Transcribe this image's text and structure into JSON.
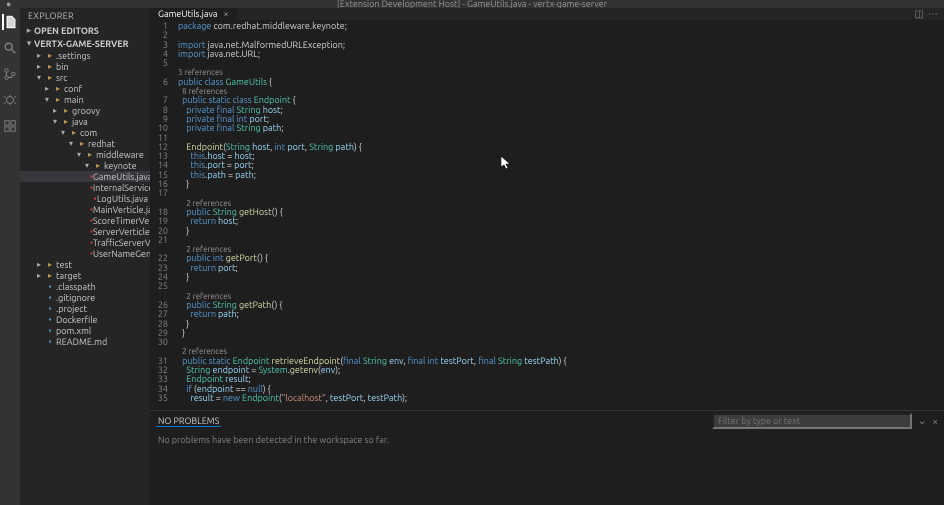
{
  "title": "[Extension Development Host] - GameUtils.java - vertx-game-server",
  "sidebar": {
    "header": "EXPLORER",
    "sections": {
      "open_editors": "OPEN EDITORS",
      "workspace": "VERTX-GAME-SERVER"
    }
  },
  "tree": [
    {
      "d": 1,
      "k": "dir",
      "t": ".settings",
      "open": false
    },
    {
      "d": 1,
      "k": "dir",
      "t": "bin",
      "open": false
    },
    {
      "d": 1,
      "k": "dir",
      "t": "src",
      "open": true
    },
    {
      "d": 2,
      "k": "dir",
      "t": "conf",
      "open": false
    },
    {
      "d": 2,
      "k": "dir",
      "t": "main",
      "open": true
    },
    {
      "d": 3,
      "k": "dir",
      "t": "groovy",
      "open": false
    },
    {
      "d": 3,
      "k": "dir",
      "t": "java",
      "open": true
    },
    {
      "d": 4,
      "k": "dir",
      "t": "com",
      "open": true
    },
    {
      "d": 5,
      "k": "dir",
      "t": "redhat",
      "open": true
    },
    {
      "d": 6,
      "k": "dir",
      "t": "middleware",
      "open": true
    },
    {
      "d": 7,
      "k": "dir",
      "t": "keynote",
      "open": true
    },
    {
      "d": 8,
      "k": "java",
      "t": "GameUtils.java",
      "sel": true
    },
    {
      "d": 8,
      "k": "java",
      "t": "InternalServiceVer…"
    },
    {
      "d": 8,
      "k": "java",
      "t": "LogUtils.java"
    },
    {
      "d": 8,
      "k": "java",
      "t": "MainVerticle.java"
    },
    {
      "d": 8,
      "k": "java",
      "t": "ScoreTimerVerticl…"
    },
    {
      "d": 8,
      "k": "java",
      "t": "ServerVerticle.java"
    },
    {
      "d": 8,
      "k": "java",
      "t": "TrafficServerVertl…"
    },
    {
      "d": 8,
      "k": "java",
      "t": "UserNameGenerat…"
    },
    {
      "d": 1,
      "k": "dir",
      "t": "test",
      "open": false,
      "red": true
    },
    {
      "d": 1,
      "k": "dir",
      "t": "target",
      "open": false
    },
    {
      "d": 1,
      "k": "file",
      "t": ".classpath"
    },
    {
      "d": 1,
      "k": "file",
      "t": ".gitignore"
    },
    {
      "d": 1,
      "k": "file",
      "t": ".project"
    },
    {
      "d": 1,
      "k": "file",
      "t": "Dockerfile"
    },
    {
      "d": 1,
      "k": "file",
      "t": "pom.xml"
    },
    {
      "d": 1,
      "k": "file",
      "t": "README.md"
    }
  ],
  "tab": {
    "name": "GameUtils.java"
  },
  "code_lines": [
    {
      "n": 1,
      "h": "<span class='kw'>package</span> <span class='ns'>com.redhat.middleware.keynote</span>;"
    },
    {
      "n": 2,
      "h": ""
    },
    {
      "n": 3,
      "h": "<span class='kw'>import</span> <span class='ns'>java.net.MalformedURLException</span>;"
    },
    {
      "n": 4,
      "h": "<span class='kw'>import</span> <span class='ns'>java.net.URL</span>;"
    },
    {
      "n": 5,
      "h": ""
    },
    {
      "n": "",
      "h": "<span class='lens'>3 references</span>"
    },
    {
      "n": 6,
      "h": "<span class='kw'>public</span> <span class='kw'>class</span> <span class='ty'>GameUtils</span> {"
    },
    {
      "n": "",
      "h": "  <span class='lens'>8 references</span>"
    },
    {
      "n": 7,
      "h": "  <span class='kw'>public</span> <span class='kw'>static</span> <span class='kw'>class</span> <span class='ty'>Endpoint</span> {"
    },
    {
      "n": 8,
      "h": "    <span class='kw'>private</span> <span class='kw'>final</span> <span class='ty'>String</span> <span class='fld'>host</span>;"
    },
    {
      "n": 9,
      "h": "    <span class='kw'>private</span> <span class='kw'>final</span> <span class='kw'>int</span> <span class='fld'>port</span>;"
    },
    {
      "n": 10,
      "h": "    <span class='kw'>private</span> <span class='kw'>final</span> <span class='ty'>String</span> <span class='fld'>path</span>;"
    },
    {
      "n": 11,
      "h": ""
    },
    {
      "n": 12,
      "h": "    <span class='fn'>Endpoint</span>(<span class='ty'>String</span> <span class='fld'>host</span>, <span class='kw'>int</span> <span class='fld'>port</span>, <span class='ty'>String</span> <span class='fld'>path</span>) {"
    },
    {
      "n": 13,
      "h": "      <span class='kw'>this</span>.<span class='fld'>host</span> = <span class='fld'>host</span>;"
    },
    {
      "n": 14,
      "h": "      <span class='kw'>this</span>.<span class='fld'>port</span> = <span class='fld'>port</span>;"
    },
    {
      "n": 15,
      "h": "      <span class='kw'>this</span>.<span class='fld'>path</span> = <span class='fld'>path</span>;"
    },
    {
      "n": 16,
      "h": "    }"
    },
    {
      "n": 17,
      "h": ""
    },
    {
      "n": "",
      "h": "    <span class='lens'>2 references</span>"
    },
    {
      "n": 18,
      "h": "    <span class='kw'>public</span> <span class='ty'>String</span> <span class='fn'>getHost</span>() {"
    },
    {
      "n": 19,
      "h": "      <span class='kw'>return</span> <span class='fld'>host</span>;"
    },
    {
      "n": 20,
      "h": "    }"
    },
    {
      "n": 21,
      "h": ""
    },
    {
      "n": "",
      "h": "    <span class='lens'>2 references</span>"
    },
    {
      "n": 22,
      "h": "    <span class='kw'>public</span> <span class='kw'>int</span> <span class='fn'>getPort</span>() {"
    },
    {
      "n": 23,
      "h": "      <span class='kw'>return</span> <span class='fld'>port</span>;"
    },
    {
      "n": 24,
      "h": "    }"
    },
    {
      "n": 25,
      "h": ""
    },
    {
      "n": "",
      "h": "    <span class='lens'>2 references</span>"
    },
    {
      "n": 26,
      "h": "    <span class='kw'>public</span> <span class='ty'>String</span> <span class='fn'>getPath</span>() {"
    },
    {
      "n": 27,
      "h": "      <span class='kw'>return</span> <span class='fld'>path</span>;"
    },
    {
      "n": 28,
      "h": "    }"
    },
    {
      "n": 29,
      "h": "  }"
    },
    {
      "n": 30,
      "h": ""
    },
    {
      "n": "",
      "h": "  <span class='lens'>2 references</span>"
    },
    {
      "n": 31,
      "h": "  <span class='kw'>public</span> <span class='kw'>static</span> <span class='ty'>Endpoint</span> <span class='fn'>retrieveEndpoint</span>(<span class='kw'>final</span> <span class='ty'>String</span> <span class='fld'>env</span>, <span class='kw'>final</span> <span class='kw'>int</span> <span class='fld'>testPort</span>, <span class='kw'>final</span> <span class='ty'>String</span> <span class='fld'>testPath</span>) {"
    },
    {
      "n": 32,
      "h": "    <span class='ty'>String</span> <span class='fld'>endpoint</span> = <span class='ty'>System</span>.<span class='fn'>getenv</span>(<span class='fld'>env</span>);"
    },
    {
      "n": 33,
      "h": "    <span class='ty'>Endpoint</span> <span class='fld'>result</span>;"
    },
    {
      "n": 34,
      "h": "    <span class='kw'>if</span> (<span class='fld'>endpoint</span> == <span class='kw'>null</span>) {"
    },
    {
      "n": 35,
      "h": "      <span class='fld'>result</span> = <span class='kw'>new</span> <span class='ty'>Endpoint</span>(<span class='st'>\"localhost\"</span>, <span class='fld'>testPort</span>, <span class='fld'>testPath</span>);"
    }
  ],
  "panel": {
    "tab": "NO PROBLEMS",
    "body": "No problems have been detected in the workspace so far.",
    "filter_placeholder": "Filter by type or text"
  }
}
